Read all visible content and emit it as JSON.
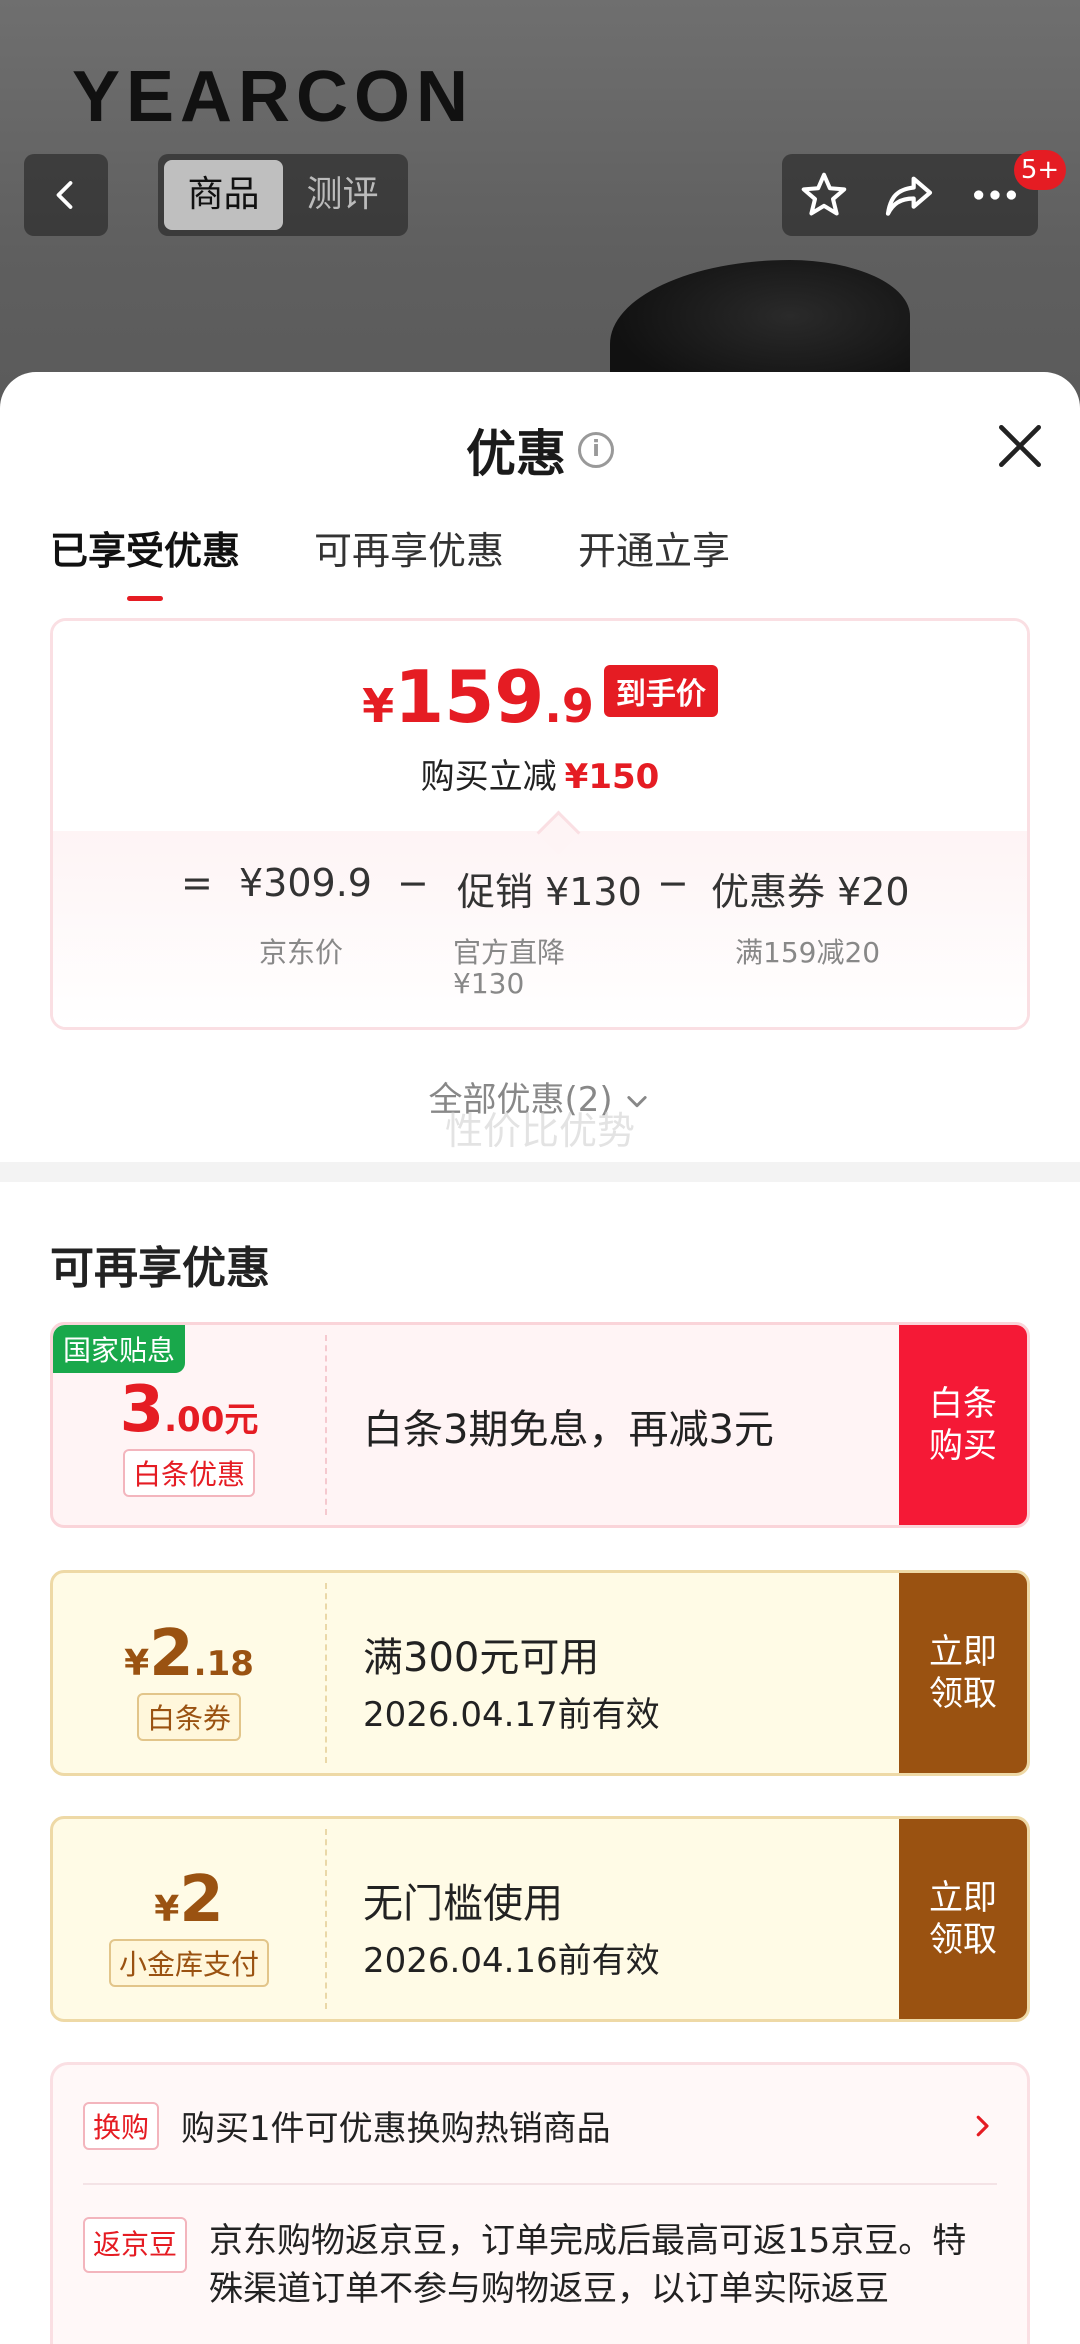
{
  "header": {
    "brand": "YEARCON",
    "tabs": [
      {
        "label": "商品"
      },
      {
        "label": "测评"
      }
    ],
    "badge": "5+"
  },
  "sheet": {
    "title": "优惠",
    "tabs": [
      {
        "label": "已享受优惠"
      },
      {
        "label": "可再享优惠"
      },
      {
        "label": "开通立享"
      }
    ]
  },
  "price_card": {
    "currency": "¥",
    "price_int": "159",
    "price_dec": ".9",
    "price_tag": "到手价",
    "save_label": "购买立减",
    "save_amount": "¥150",
    "formula": {
      "eq": "=",
      "base": "¥309.9",
      "minus1": "−",
      "promo": "促销 ¥130",
      "minus2": "−",
      "coupon": "优惠券 ¥20",
      "base_label": "京东价",
      "promo_label_1": "官方直降",
      "promo_label_2": "¥130",
      "coupon_label": "满159减20"
    },
    "all_link": "全部优惠(2)",
    "watermark": "性价比优势"
  },
  "more": {
    "title": "可再享优惠",
    "coupons": [
      {
        "tag": "国家贴息",
        "amount_main": "3",
        "amount_dec": ".00元",
        "label": "白条优惠",
        "line1": "白条3期免息，再减3元",
        "line2": "",
        "action": "白条\n购买"
      },
      {
        "tag": "",
        "yen": "¥",
        "amount_main": "2",
        "amount_dec": ".18",
        "label": "白条券",
        "line1": "满300元可用",
        "line2": "2026.04.17前有效",
        "action": "立即\n领取"
      },
      {
        "tag": "",
        "yen": "¥",
        "amount_main": "2",
        "amount_dec": "",
        "label": "小金库支付",
        "line1": "无门槛使用",
        "line2": "2026.04.16前有效",
        "action": "立即\n领取"
      }
    ],
    "perks": [
      {
        "tag": "换购",
        "text": "购买1件可优惠换购热销商品"
      },
      {
        "tag": "返京豆",
        "text": "京东购物返京豆，订单完成后最高可返15京豆。特殊渠道订单不参与购物返豆，以订单实际返豆"
      }
    ]
  }
}
